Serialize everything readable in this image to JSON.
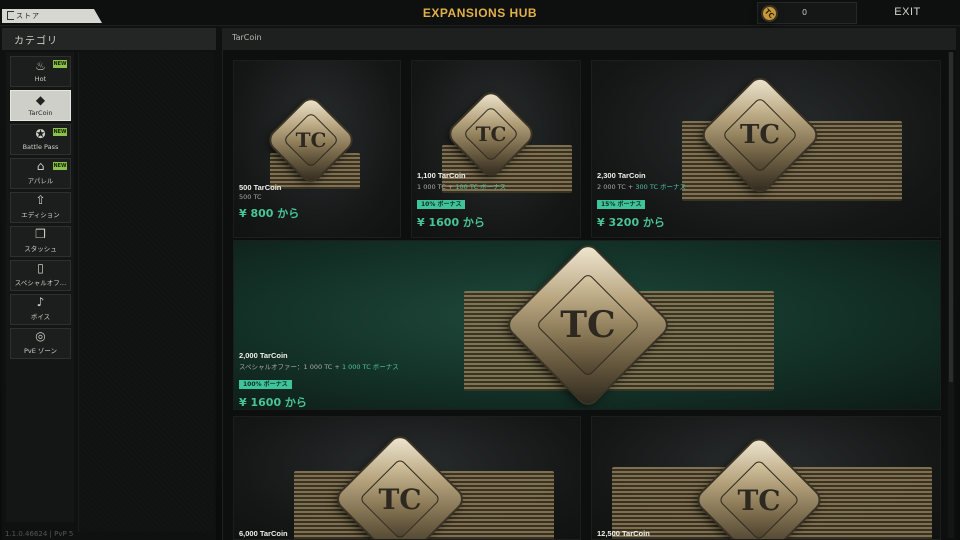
{
  "header": {
    "store_tab_label": "ストア",
    "title": "EXPANSIONS HUB",
    "balance_value": "0",
    "exit_label": "EXIT",
    "balance_icon": "tc-coin-icon"
  },
  "sidebar": {
    "title": "カテゴリ",
    "items": [
      {
        "label": "Hot",
        "icon": "flame-icon",
        "new": true,
        "active": false
      },
      {
        "label": "TarCoin",
        "icon": "tc-coin-icon",
        "new": false,
        "active": true
      },
      {
        "label": "Battle Pass",
        "icon": "badge-icon",
        "new": true,
        "active": false
      },
      {
        "label": "アパレル",
        "icon": "hanger-icon",
        "new": true,
        "active": false
      },
      {
        "label": "エディション",
        "icon": "arrow-up-circle-icon",
        "new": false,
        "active": false
      },
      {
        "label": "スタッシュ",
        "icon": "cube-icon",
        "new": false,
        "active": false
      },
      {
        "label": "スペシャルオフ…",
        "icon": "phone-card-icon",
        "new": false,
        "active": false
      },
      {
        "label": "ボイス",
        "icon": "speaker-icon",
        "new": false,
        "active": false
      },
      {
        "label": "PvE ゾーン",
        "icon": "target-icon",
        "new": false,
        "active": false
      }
    ],
    "new_badge": "NEW"
  },
  "content": {
    "section_title": "TarCoin",
    "cards": [
      {
        "name": "500 TarCoin",
        "desc": "500 TC",
        "desc_bonus": "",
        "bonus": "",
        "price": "¥ 800 から"
      },
      {
        "name": "1,100 TarCoin",
        "desc": "1 000 TC + ",
        "desc_bonus": "100 TC ボーナス",
        "bonus": "10% ボーナス",
        "price": "¥ 1600 から"
      },
      {
        "name": "2,300 TarCoin",
        "desc": "2 000 TC + ",
        "desc_bonus": "300 TC ボーナス",
        "bonus": "15% ボーナス",
        "price": "¥ 3200 から"
      },
      {
        "name": "2,000 TarCoin",
        "desc": "スペシャルオファー：1 000 TC + ",
        "desc_bonus": "1 000 TC ボーナス",
        "bonus": "100% ボーナス",
        "price": "¥ 1600 から"
      },
      {
        "name": "6,000 TarCoin",
        "desc": "",
        "desc_bonus": "",
        "bonus": "",
        "price": ""
      },
      {
        "name": "12,500 TarCoin",
        "desc": "",
        "desc_bonus": "",
        "bonus": "",
        "price": ""
      }
    ],
    "coin_mark": "TC"
  },
  "footer": {
    "version": "1.1.0.46624 | PvP 5"
  },
  "colors": {
    "accent_gold": "#e1b04a",
    "price_green": "#48c596",
    "bonus_green": "#3fc49a",
    "new_green": "#8bc34a"
  }
}
